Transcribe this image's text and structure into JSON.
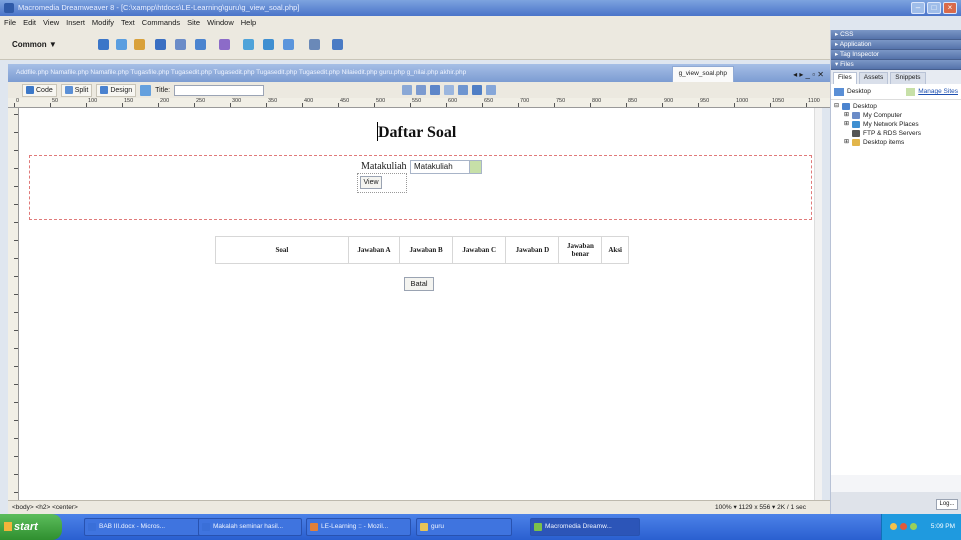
{
  "window": {
    "title": "Macromedia Dreamweaver 8 - [C:\\xampp\\htdocs\\LE-Learning\\guru\\g_view_soal.php]",
    "controls": [
      "–",
      "□",
      "×"
    ]
  },
  "menu": [
    "File",
    "Edit",
    "View",
    "Insert",
    "Modify",
    "Text",
    "Commands",
    "Site",
    "Window",
    "Help"
  ],
  "insert_bar": {
    "category": "Common ▼"
  },
  "doc_tabs": {
    "tabs": "Addfile.php   Namafile.php   Namafile.php   Tugasfile.php   Tugasedit.php   Tugasedit.php   Tugasedit.php   Tugasedit.php   Nilaiedit.php   guru.php   g_nilai.php   akhir.php",
    "active": "g_view_soal.php",
    "controls": "◂ ▸ _ ▫ ✕"
  },
  "doc_toolbar": {
    "code": "Code",
    "split": "Split",
    "design": "Design",
    "title_label": "Title:"
  },
  "ruler_numbers": [
    "0",
    "50",
    "100",
    "150",
    "200",
    "250",
    "300",
    "350",
    "400",
    "450",
    "500",
    "550",
    "600",
    "650",
    "700",
    "750",
    "800",
    "850",
    "900",
    "950",
    "1000",
    "1050",
    "1100"
  ],
  "page": {
    "heading": "Daftar Soal",
    "matakuliah_label": "Matakuliah",
    "matakuliah_value": "Matakuliah",
    "view_button": "View",
    "table_headers": [
      "Soal",
      "Jawaban A",
      "Jawaban B",
      "Jawaban C",
      "Jawaban D",
      "Jawaban benar",
      "Aksi"
    ],
    "batal_button": "Batal"
  },
  "status": {
    "tags": "<body> <h2> <center>",
    "info": "100% ▾ 1129 x 556 ▾ 2K / 1 sec"
  },
  "panels": {
    "css": "▸ CSS",
    "application": "▸ Application",
    "tag_inspector": "▸ Tag Inspector",
    "files": "▾ Files",
    "tabs": [
      "Files",
      "Assets",
      "Snippets"
    ],
    "site": "Desktop",
    "manage_sites": "Manage Sites",
    "tree": [
      "Desktop",
      "My Computer",
      "My Network Places",
      "FTP & RDS Servers",
      "Desktop items"
    ],
    "log_button": "Log..."
  },
  "taskbar": {
    "start": "start",
    "tasks": [
      "BAB III.docx - Micros...",
      "Makalah seminar hasil...",
      "LE-Learning :: - Mozil...",
      "guru",
      "Macromedia Dreamw..."
    ],
    "clock": "5:09 PM"
  }
}
